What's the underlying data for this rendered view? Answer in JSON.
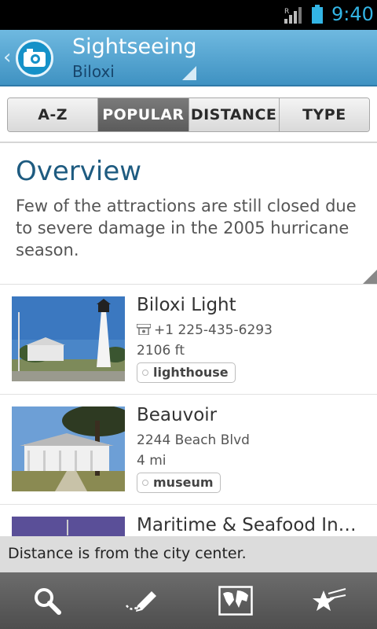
{
  "status_bar": {
    "time": "9:40",
    "signal_label": "R"
  },
  "action_bar": {
    "title": "Sightseeing",
    "subtitle": "Biloxi",
    "back_glyph": "‹"
  },
  "sort_tabs": [
    {
      "label": "A-Z",
      "active": false
    },
    {
      "label": "POPULAR",
      "active": true
    },
    {
      "label": "DISTANCE",
      "active": false
    },
    {
      "label": "TYPE",
      "active": false
    }
  ],
  "overview": {
    "heading": "Overview",
    "text": "Few of the attractions are still closed due to severe damage in the 2005 hurricane season."
  },
  "attractions": [
    {
      "name": "Biloxi Light",
      "phone": "+1 225-435-6293",
      "distance": "2106 ft",
      "tag": "lighthouse"
    },
    {
      "name": "Beauvoir",
      "address": "2244 Beach Blvd",
      "distance": "4 mi",
      "tag": "museum"
    },
    {
      "name": "Maritime & Seafood Indu…"
    }
  ],
  "toast": {
    "message": "Distance is from the city center."
  },
  "bottom_bar": {
    "icons": [
      "search-icon",
      "edit-icon",
      "map-icon",
      "favorites-icon"
    ]
  },
  "colors": {
    "accent": "#33b5e5",
    "action_bar": "#4fa3d2",
    "heading": "#1e5b80"
  }
}
